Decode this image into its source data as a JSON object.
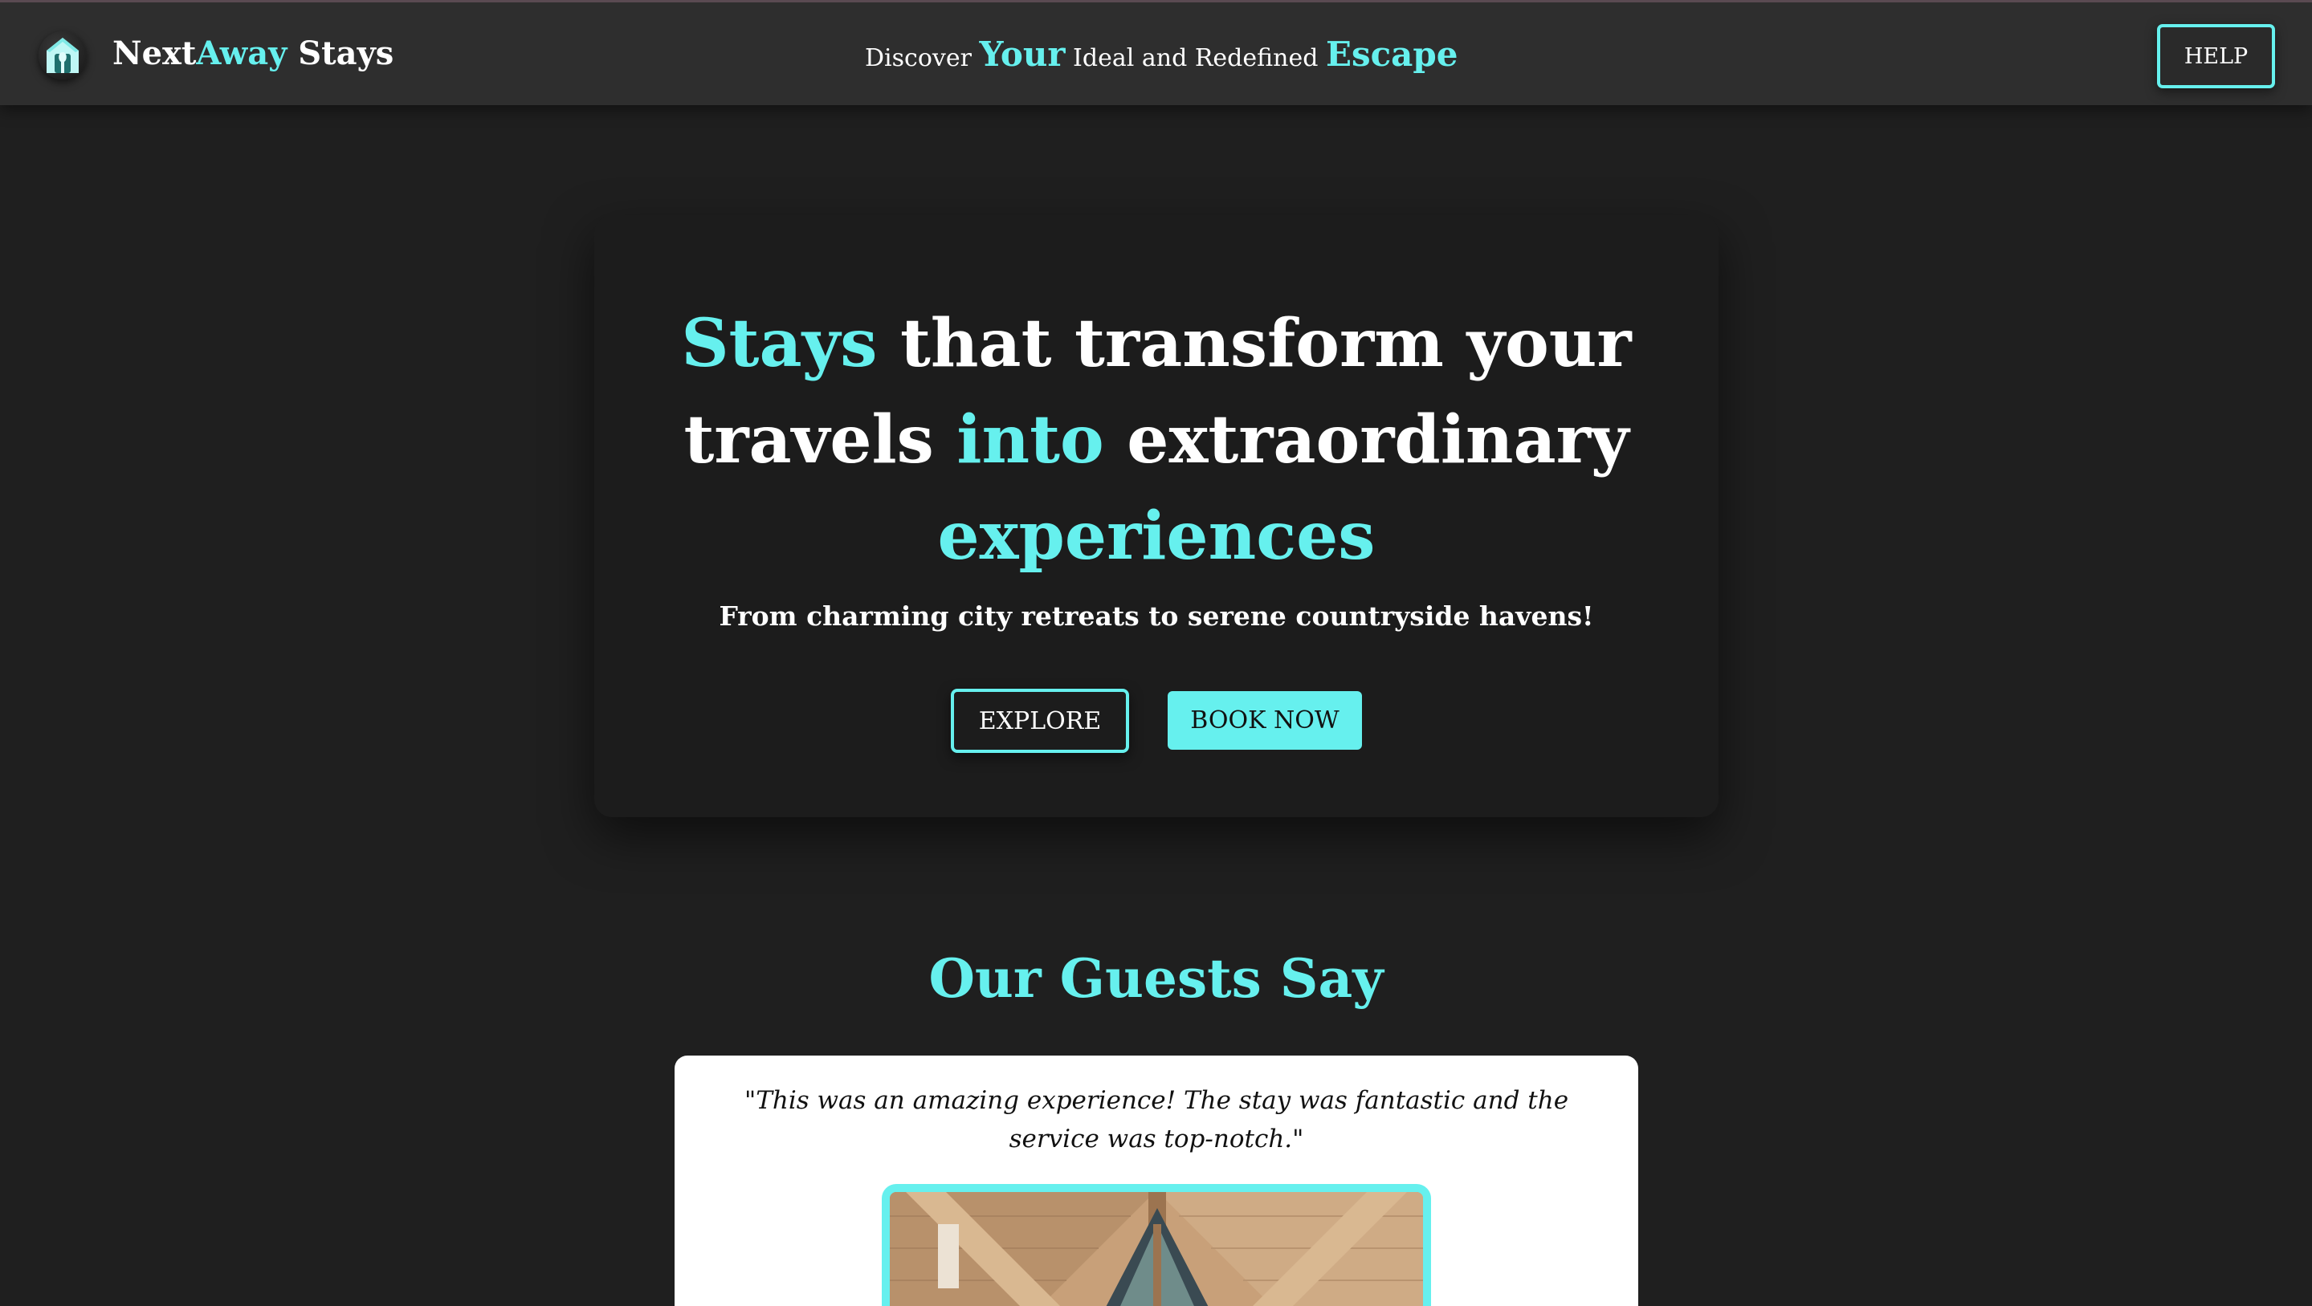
{
  "header": {
    "brand": {
      "part1": "Next",
      "part2": "Away",
      "part3": " Stays"
    },
    "tagline": {
      "w1": "Discover ",
      "w2": "Your",
      "w3": " Ideal and Redefined ",
      "w4": "Escape"
    },
    "help_label": "HELP",
    "logo_icon": "house-icon"
  },
  "hero": {
    "title": {
      "t1": "Stays",
      "t2": " that transform your",
      "t3": "travels ",
      "t4": "into",
      "t5": " extraordinary",
      "t6": "experiences"
    },
    "subtitle": "From charming city retreats to serene countryside havens!",
    "explore_label": "EXPLORE",
    "book_label": "BOOK NOW"
  },
  "testimonials": {
    "title": "Our Guests Say",
    "quote": "\"This was an amazing experience! The stay was fantastic and the service was top-notch.\""
  },
  "colors": {
    "accent": "#66f0ee",
    "background": "#1f1f1f",
    "header": "#2e2e2e",
    "card": "#1c1c1c"
  }
}
